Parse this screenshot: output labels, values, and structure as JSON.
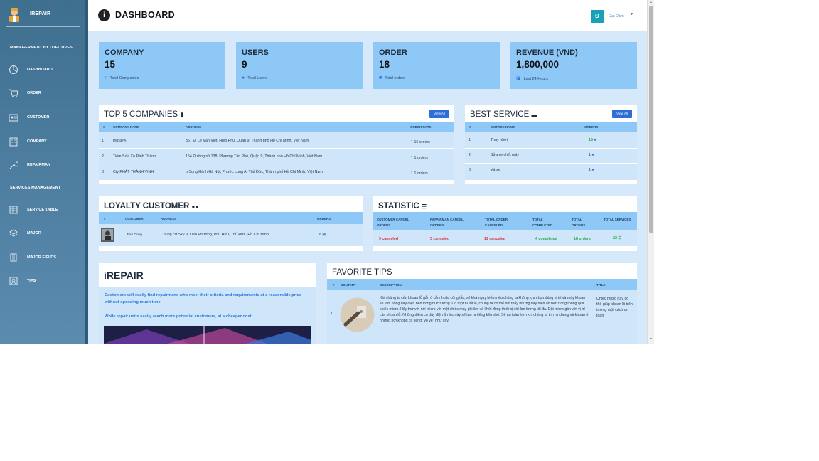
{
  "brand": {
    "name": "IREPAIR"
  },
  "sidebar": {
    "section_1": "MANAGERMENT BY OJECTIVES",
    "section_2": "SERVICES MANAGEMENT",
    "items": [
      {
        "label": "DASHBOARD",
        "icon": "pie-chart-icon"
      },
      {
        "label": "ORDER",
        "icon": "cart-icon"
      },
      {
        "label": "CUSTOMER",
        "icon": "id-card-icon"
      },
      {
        "label": "COMPANY",
        "icon": "building-icon"
      },
      {
        "label": "REPAIRMAN",
        "icon": "wrench-icon"
      },
      {
        "label": "SERVICE TABLE",
        "icon": "table-icon"
      },
      {
        "label": "MAJOR",
        "icon": "layers-icon"
      },
      {
        "label": "MAJOR FIELDS",
        "icon": "fields-icon"
      },
      {
        "label": "TIPS",
        "icon": "tips-icon"
      }
    ]
  },
  "header": {
    "title": "DASHBOARD",
    "avatar_letter": "Đ",
    "user_name": "Đạt Đàm"
  },
  "stats": [
    {
      "title": "COMPANY",
      "value": "15",
      "sub": "Total Companies",
      "icon": "arrow-up-icon"
    },
    {
      "title": "USERS",
      "value": "9",
      "sub": "Total Users",
      "icon": "user-circle-icon"
    },
    {
      "title": "ORDER",
      "value": "18",
      "sub": "Total orders",
      "icon": "truck-icon"
    },
    {
      "title": "REVENUE (VND)",
      "value": "1,800,000",
      "sub": "Last 24 Hours",
      "icon": "id-badge-icon"
    }
  ],
  "top_companies": {
    "title": "TOP 5 COMPANIES",
    "view_all": "View All",
    "headers": [
      "#",
      "COMPANY NAME",
      "ADDRESS",
      "ORDER RATE"
    ],
    "rows": [
      {
        "n": "1",
        "name": "IrepairX",
        "address": "367 Đ. Lê Văn Việt, Hiệp Phú, Quận 9, Thành phố Hồ Chí Minh, Việt Nam",
        "rate": "16 orders"
      },
      {
        "n": "2",
        "name": "Tiệm Sửa Xe Đình Thành",
        "address": "154 Đường số 138, Phường Tân Phú, Quận 9, Thành phố Hồ Chí Minh, Việt Nam",
        "rate": "1 orders"
      },
      {
        "n": "3",
        "name": "Cty PHÁT THÀNH VINH",
        "address": "p Song Hành Hà Nội, Phước Long A, Thủ Đức, Thành phố Hồ Chí Minh, Việt Nam",
        "rate": "1 orders"
      }
    ]
  },
  "best_service": {
    "title": "BEST SERVICE",
    "view_all": "View All",
    "headers": [
      "#",
      "SERVICE NAME",
      "ORDERS"
    ],
    "rows": [
      {
        "n": "1",
        "name": "Thay nhớt",
        "orders": "16"
      },
      {
        "n": "2",
        "name": "Sửa xe chết máy",
        "orders": "1"
      },
      {
        "n": "3",
        "name": "Vá xe",
        "orders": "1"
      }
    ]
  },
  "loyalty": {
    "title": "LOYALTY CUSTOMER",
    "headers": [
      "#",
      "CUSTOMER",
      "ADDRESS",
      "ORDERS"
    ],
    "rows": [
      {
        "name": "Tam Dong",
        "address": "Chung cư Sky 9, Liên Phường, Phú Hữu, Thủ Đức, Hồ Chí Minh",
        "orders": "18"
      }
    ]
  },
  "statistic": {
    "title": "STATISTIC",
    "headers": [
      "CUSTOMER CANCEL ORDERS",
      "REPAIRMAN CANCEL ORDERS",
      "TOTAL ORDER CANCELED",
      "TOTAL COMPLETED",
      "TOTAL ORDERS",
      "TOTAL SERVICES"
    ],
    "values": [
      "9 canceled",
      "3 canceled",
      "12 canceled",
      "4 completed",
      "18 orders",
      "22"
    ]
  },
  "irepair": {
    "title": "iREPAIR",
    "p1": "Customers will easily find repairmans who meet their criteria and requirements at a reasonable price without spending much time.",
    "p2": "While repair units easily reach more potential customers, at a cheaper cost."
  },
  "tips": {
    "title": "FAVORITE TIPS",
    "headers": [
      "#",
      "CONTENT",
      "DESCRIPTION",
      "TITLE"
    ],
    "rows": [
      {
        "n": "1",
        "description": "Khi chúng ta cần khoan lỗ gắn ổ cắm hoặc công tắc, sẽ khá nguy hiểm nếu chúng ta không lựa chọn đúng vị trí và máy khoan sẽ làm hỏng dây điện bên trong bức tường. Có một bí tốt là, chúng ta có thể tìm thấy những dây điện ẩn bên trong thông qua chiếc micro. Hãy thử với nối micro với một chiếc máy ghi âm và khởi động thiết bị với âm lượng tối đa. Đặt micro gần với vị trí cần khoan lỗ. Những điểm có dây điện ẩn lúc này sẽ tạo ra tiếng kêu nhỏ. Sẽ an toàn hơn khi chúng ta tìm ra chúng và khoan ở những nơi không có tiếng \"vo ve\" như vậy.",
        "title": "Chiếc micro này có thể giúp khoan lỗ trên tường một cách an toàn"
      }
    ]
  }
}
